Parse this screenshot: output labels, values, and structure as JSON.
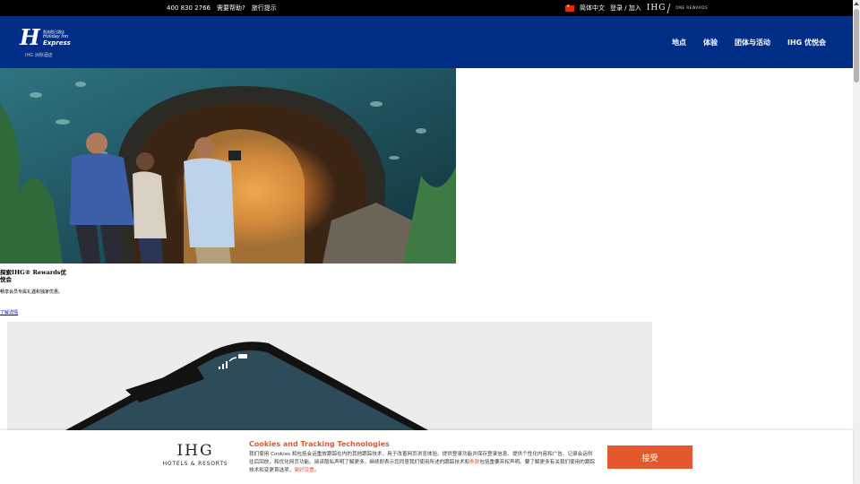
{
  "topbar": {
    "phone": "400 830 2766",
    "help": "需要帮助?",
    "travel_tips": "旅行提示",
    "language": "简体中文",
    "login": "登录 / 加入",
    "ihg_logo": "IHG",
    "one_rewards": "ONE REWARDS"
  },
  "header": {
    "logo": {
      "brand_cn": "智选假日酒店",
      "brand_line1": "Holiday Inn",
      "brand_line2": "Express",
      "tag": "IHG 洲际酒店"
    },
    "nav": [
      "地点",
      "体验",
      "团体与活动",
      "IHG 优悦会"
    ]
  },
  "promo": {
    "title": "探索IHG® Rewards优悦会",
    "description": "畅享会员专属礼遇和独家优惠。",
    "link": "了解详情"
  },
  "cookie": {
    "logo_main": "IHG",
    "logo_sub": "HOTELS & RESORTS",
    "title": "Cookies and Tracking Technologies",
    "text_1": "我们使用 Cookies 和包括会话重放跟踪在内的其他跟踪技术，用于改善网页浏览体验、提供登录功能并保存登录信息、提供个性化内容和广告、记录会话供往后回放，和优化网页功能。阅读隐私声明了解更多。继续即表示您同意我们使用所述的跟踪技术和",
    "link_terms": "条款",
    "text_2": "包括重要弃权声明。要了解更多有关我们使用的跟踪技术和变更首选项，",
    "link_settings": "偏好设置",
    "text_3": "。",
    "accept": "接受"
  },
  "colors": {
    "header_blue": "#002d86",
    "accent_orange": "#e3582c",
    "topbar_black": "#000000"
  }
}
